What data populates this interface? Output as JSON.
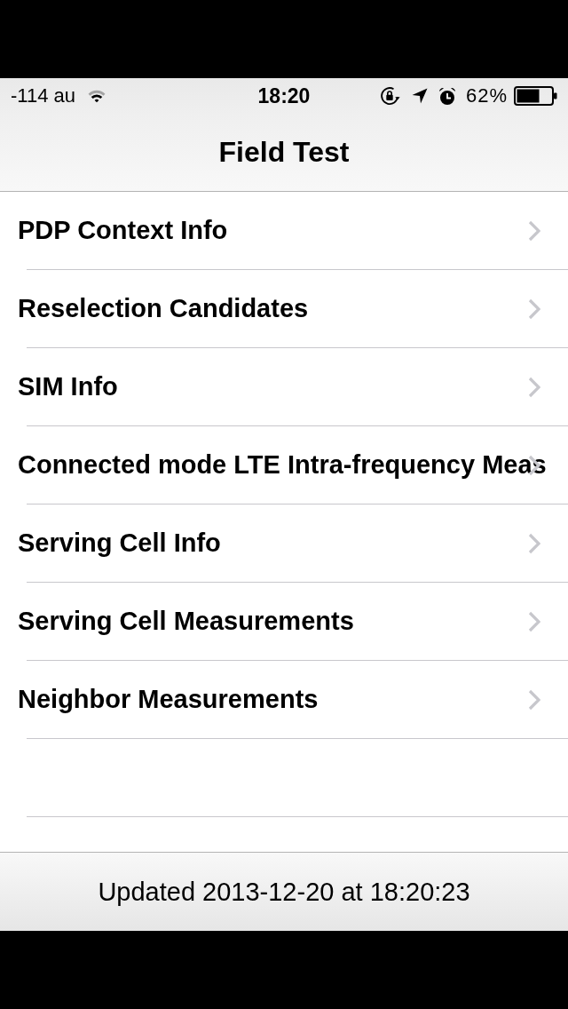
{
  "status_bar": {
    "carrier": "-114 au",
    "time": "18:20",
    "battery_percent": "62%"
  },
  "nav_bar": {
    "title": "Field Test"
  },
  "list": {
    "items": [
      {
        "label": "PDP Context Info"
      },
      {
        "label": "Reselection Candidates"
      },
      {
        "label": "SIM Info"
      },
      {
        "label": "Connected mode LTE Intra-frequency Meas"
      },
      {
        "label": "Serving Cell Info"
      },
      {
        "label": "Serving Cell Measurements"
      },
      {
        "label": "Neighbor Measurements"
      }
    ]
  },
  "toolbar": {
    "status": "Updated 2013-12-20 at 18:20:23"
  }
}
